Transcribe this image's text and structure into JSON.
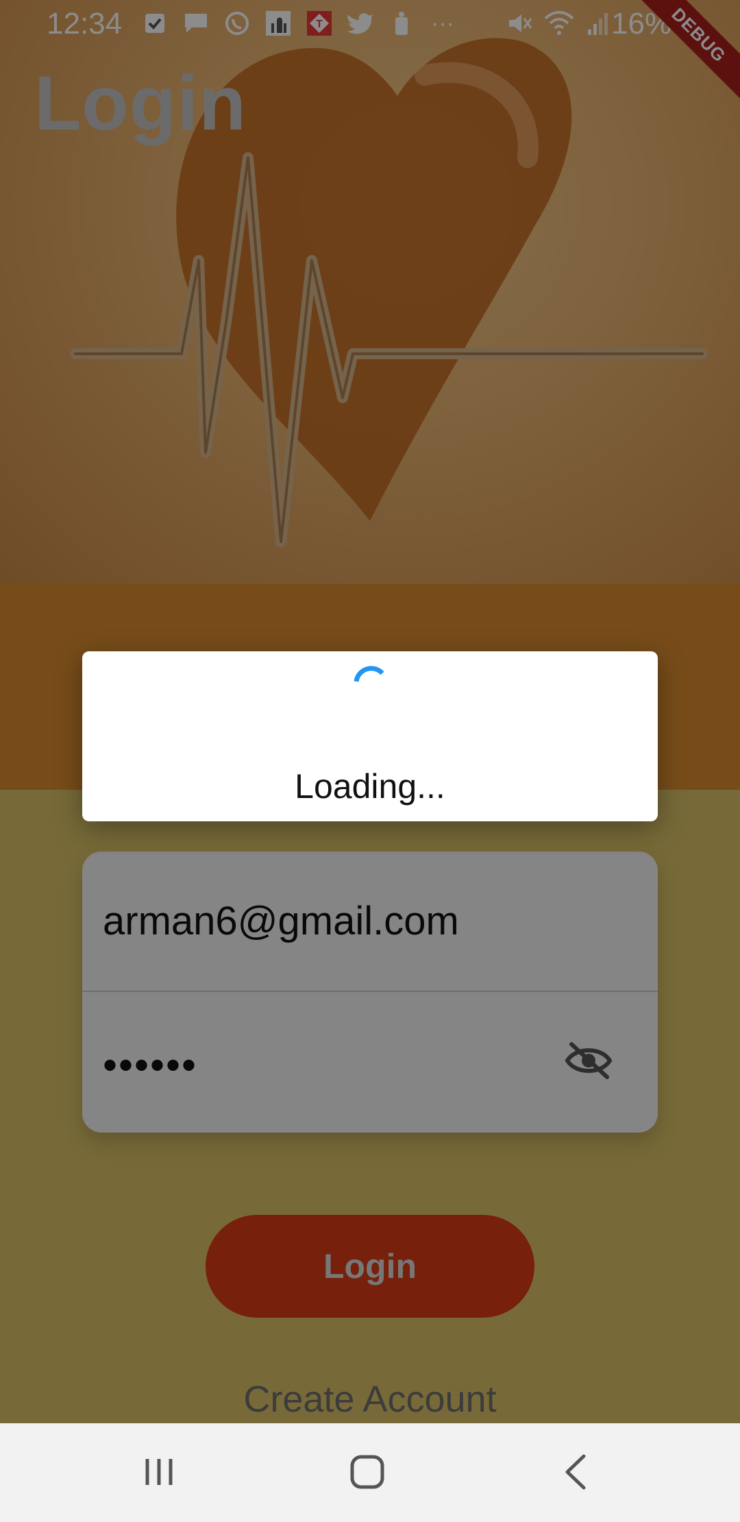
{
  "status_bar": {
    "time": "12:34",
    "battery": "16%",
    "debug_banner": "DEBUG",
    "overflow": "···"
  },
  "login_page": {
    "title": "Login",
    "email_value": "arman6@gmail.com",
    "password_value": "••••••",
    "login_button": "Login",
    "create_account": "Create Account"
  },
  "dialog": {
    "message": "Loading..."
  },
  "colors": {
    "accent": "#2196f3",
    "login_button": "#d93b17",
    "band": "#d98a2e",
    "debug": "#a8201a"
  },
  "icons": [
    "check-icon",
    "message-icon",
    "whatsapp-icon",
    "mosque-icon",
    "tv-icon",
    "twitter-icon",
    "app-icon",
    "mute-icon",
    "wifi-icon",
    "signal-icon",
    "battery-icon",
    "eye-off-icon",
    "recent-apps-icon",
    "home-icon",
    "back-icon"
  ]
}
